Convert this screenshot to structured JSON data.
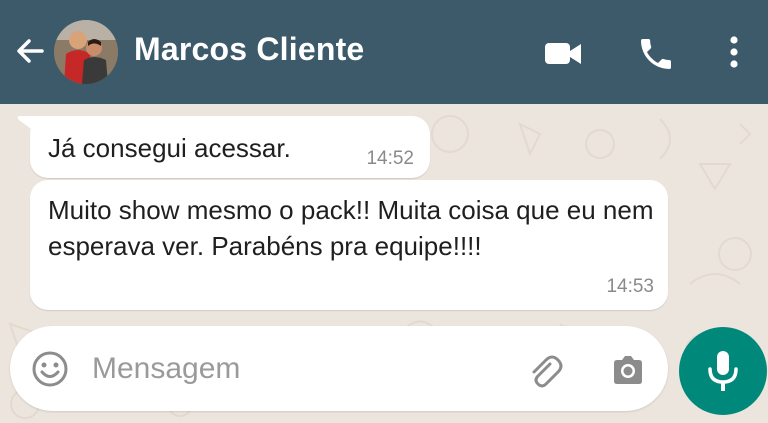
{
  "header": {
    "contact_name": "Marcos Cliente",
    "icons": [
      "back-arrow-icon",
      "video-call-icon",
      "phone-call-icon",
      "more-vert-icon"
    ]
  },
  "messages": [
    {
      "text": "Já consegui acessar.",
      "time": "14:52"
    },
    {
      "text": "Muito show mesmo o pack!! Muita coisa que eu nem esperava ver. Parabéns pra equipe!!!!",
      "time": "14:53"
    }
  ],
  "composer": {
    "placeholder": "Mensagem",
    "icons": [
      "emoji-icon",
      "attach-icon",
      "camera-icon",
      "mic-icon"
    ]
  },
  "colors": {
    "header_bg": "#3c5a6a",
    "chat_bg": "#ece5dd",
    "bubble_bg": "#ffffff",
    "mic_button": "#00897b"
  }
}
